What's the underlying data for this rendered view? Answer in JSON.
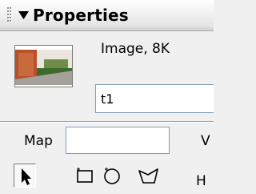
{
  "panel": {
    "title": "Properties",
    "collapse_icon": "triangle-down-icon"
  },
  "image": {
    "info": "Image, 8K",
    "name_value": "t1"
  },
  "map": {
    "label": "Map",
    "value": ""
  },
  "partial_labels": {
    "v": "V",
    "h": "H"
  },
  "hotspot_tools": [
    {
      "name": "pointer-hotspot-tool",
      "icon": "arrow-pointer-icon",
      "selected": true
    },
    {
      "name": "rectangle-hotspot-tool",
      "icon": "rectangle-hotspot-icon",
      "selected": false
    },
    {
      "name": "oval-hotspot-tool",
      "icon": "circle-hotspot-icon",
      "selected": false
    },
    {
      "name": "polygon-hotspot-tool",
      "icon": "polygon-hotspot-icon",
      "selected": false
    }
  ],
  "colors": {
    "panel_bg": "#f0f0f0",
    "field_border": "#7f9db9"
  }
}
